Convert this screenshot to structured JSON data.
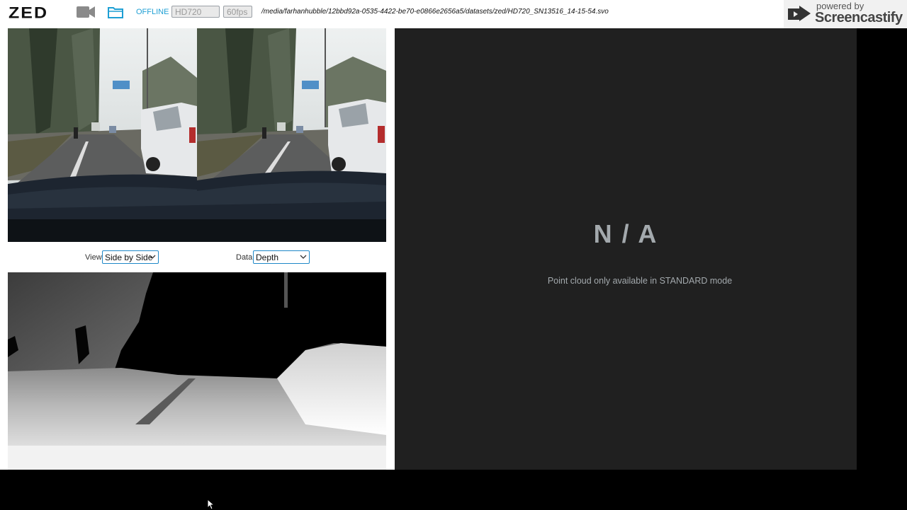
{
  "header": {
    "logo": "ZED",
    "mode_label": "OFFLINE",
    "resolution_value": "HD720",
    "fps_value": "60fps",
    "file_path": "/media/farhanhubble/12bbd92a-0535-4422-be70-e0866e2656a5/datasets/zed/HD720_SN13516_14-15-54.svo",
    "icons": [
      "camera-icon",
      "folder-icon"
    ],
    "accent_color": "#1e9fd4"
  },
  "watermark": {
    "powered": "powered by",
    "brand": "Screencastify"
  },
  "controls": {
    "view_label": "View",
    "view_value": "Side by Side",
    "data_label": "Data",
    "data_value": "Depth"
  },
  "point_cloud": {
    "status": "N / A",
    "message": "Point cloud only available in STANDARD mode"
  }
}
